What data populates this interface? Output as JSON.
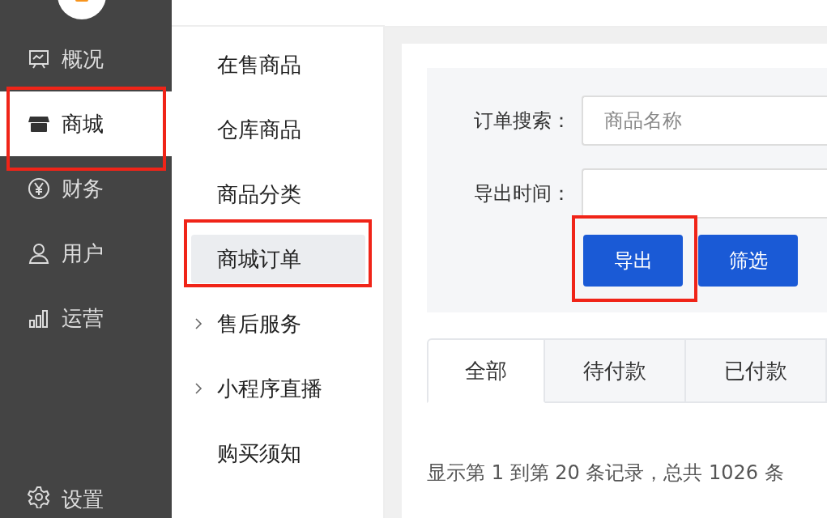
{
  "sidebar": {
    "items": [
      {
        "label": "概况",
        "selected": false,
        "highlighted": false
      },
      {
        "label": "商城",
        "selected": true,
        "highlighted": true
      },
      {
        "label": "财务",
        "selected": false,
        "highlighted": false
      },
      {
        "label": "用户",
        "selected": false,
        "highlighted": false
      },
      {
        "label": "运营",
        "selected": false,
        "highlighted": false
      }
    ],
    "footer_item": {
      "label": "设置"
    }
  },
  "submenu": {
    "items": [
      {
        "label": "在售商品",
        "selected": false,
        "expandable": false,
        "highlighted": false
      },
      {
        "label": "仓库商品",
        "selected": false,
        "expandable": false,
        "highlighted": false
      },
      {
        "label": "商品分类",
        "selected": false,
        "expandable": false,
        "highlighted": false
      },
      {
        "label": "商城订单",
        "selected": true,
        "expandable": false,
        "highlighted": true
      },
      {
        "label": "售后服务",
        "selected": false,
        "expandable": true,
        "highlighted": false
      },
      {
        "label": "小程序直播",
        "selected": false,
        "expandable": true,
        "highlighted": false
      },
      {
        "label": "购买须知",
        "selected": false,
        "expandable": false,
        "highlighted": false
      }
    ]
  },
  "filter": {
    "fields": [
      {
        "label": "订单搜索：",
        "placeholder": "商品名称"
      },
      {
        "label": "导出时间："
      }
    ],
    "buttons": [
      {
        "label": "导出",
        "highlighted": true
      },
      {
        "label": "筛选",
        "highlighted": false
      }
    ]
  },
  "tabs": [
    {
      "label": "全部",
      "selected": true
    },
    {
      "label": "待付款",
      "selected": false
    },
    {
      "label": "已付款",
      "selected": false
    }
  ],
  "record_summary": "显示第 1 到第 20 条记录，总共 1026 条"
}
